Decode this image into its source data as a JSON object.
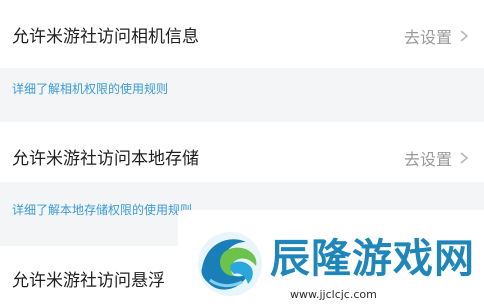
{
  "settings": [
    {
      "title": "允许米游社访问相机信息",
      "action": "去设置",
      "link": "详细了解相机权限的使用规则"
    },
    {
      "title": "允许米游社访问本地存储",
      "action": "去设置",
      "link": "详细了解本地存储权限的使用规则"
    },
    {
      "title": "允许米游社访问悬浮"
    }
  ],
  "watermark": {
    "site_name": "辰隆游戏网",
    "url": "www.jjclcjc.com"
  },
  "icons": {
    "chevron": "chevron-right-icon",
    "logo": "wave-logo-icon"
  },
  "colors": {
    "link": "#3a9bd8",
    "watermark": "#1f86b9"
  }
}
